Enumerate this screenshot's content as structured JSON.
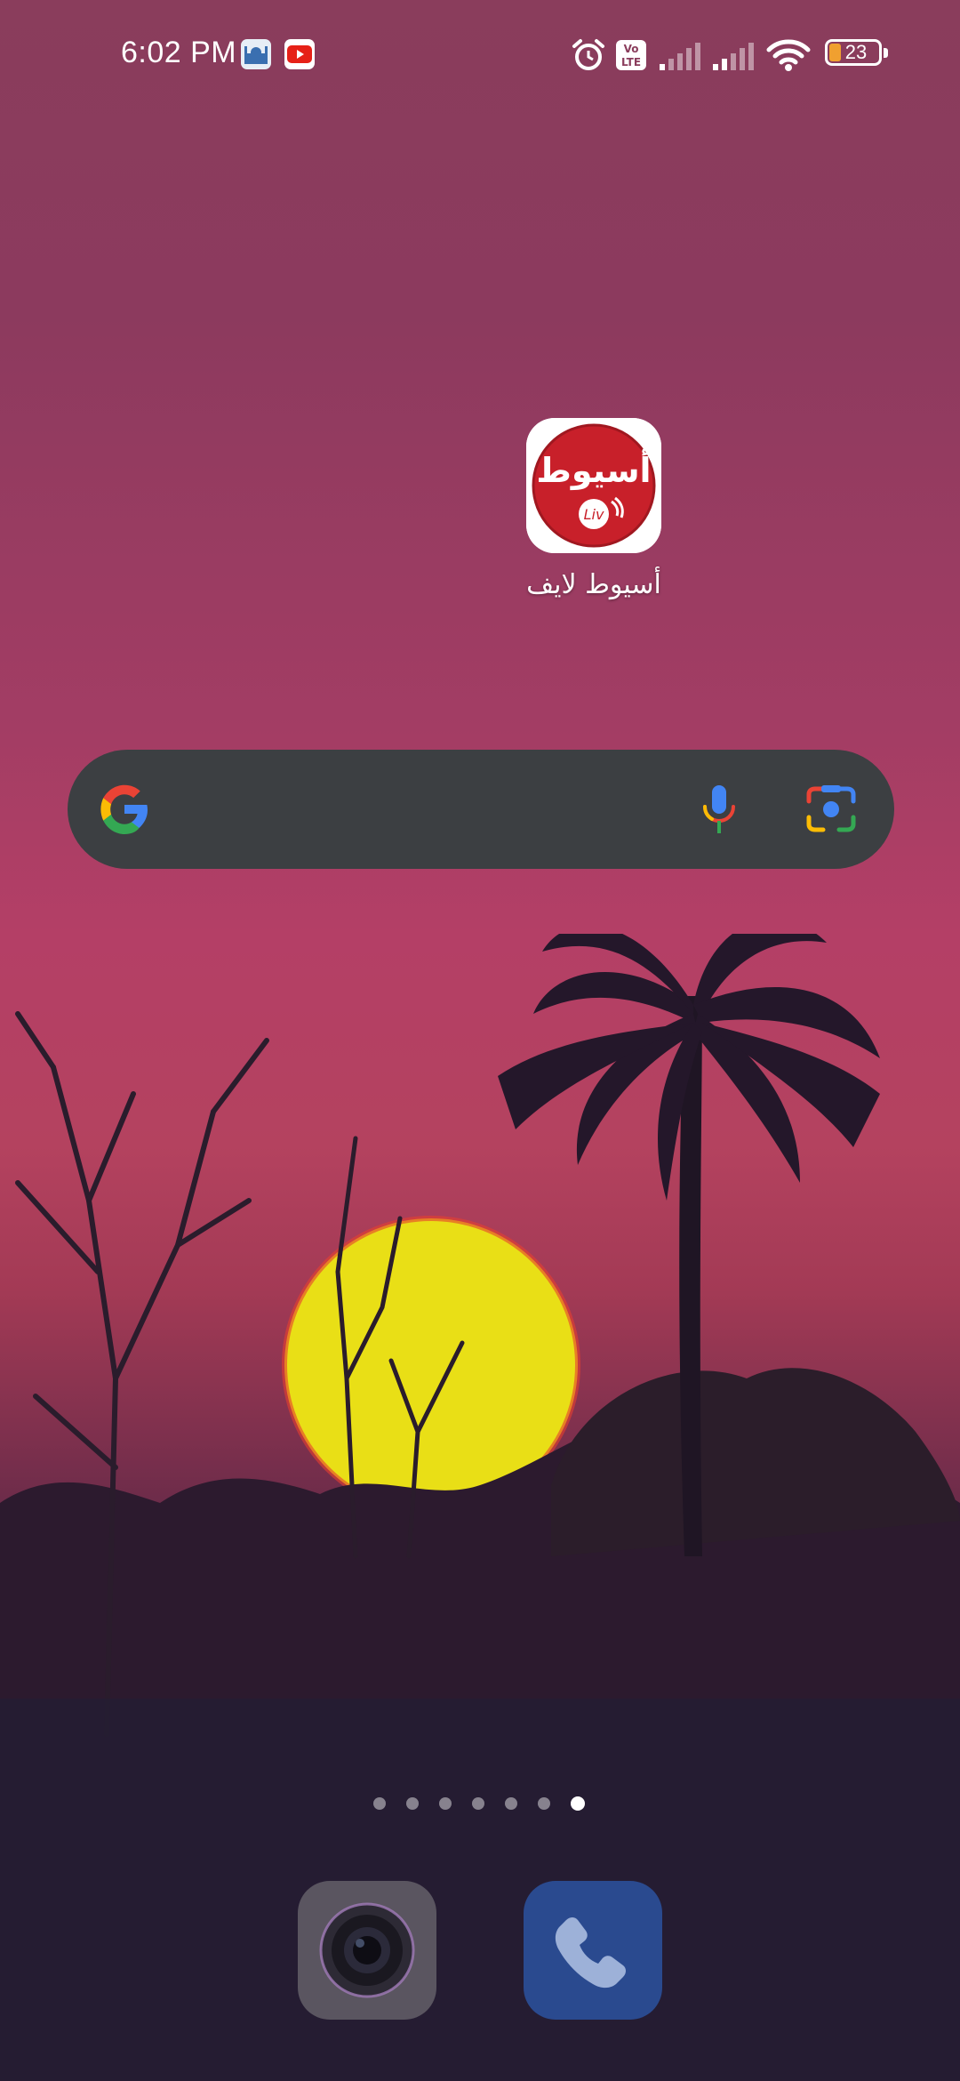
{
  "status_bar": {
    "time": "6:02 PM",
    "notifications": [
      "mosque-app-icon",
      "youtube-icon"
    ],
    "system_icons": [
      "alarm-icon",
      "volte-icon",
      "signal-icon",
      "signal-icon",
      "wifi-icon",
      "battery-icon"
    ],
    "volte_label": "Vo LTE",
    "battery_level": "23"
  },
  "home": {
    "app": {
      "icon_text_top": "أسيوط",
      "icon_text_bottom": "Liv",
      "label": "أسيوط لايف"
    }
  },
  "search": {
    "icons": [
      "google-g-icon",
      "mic-icon",
      "lens-icon"
    ]
  },
  "pager": {
    "pages": 7,
    "active_index": 6
  },
  "dock": {
    "apps": [
      "camera",
      "phone"
    ]
  },
  "colors": {
    "search_bar_bg": "#3c3f42",
    "app_icon_red": "#c8202a",
    "phone_blue": "#2a4a8f"
  }
}
